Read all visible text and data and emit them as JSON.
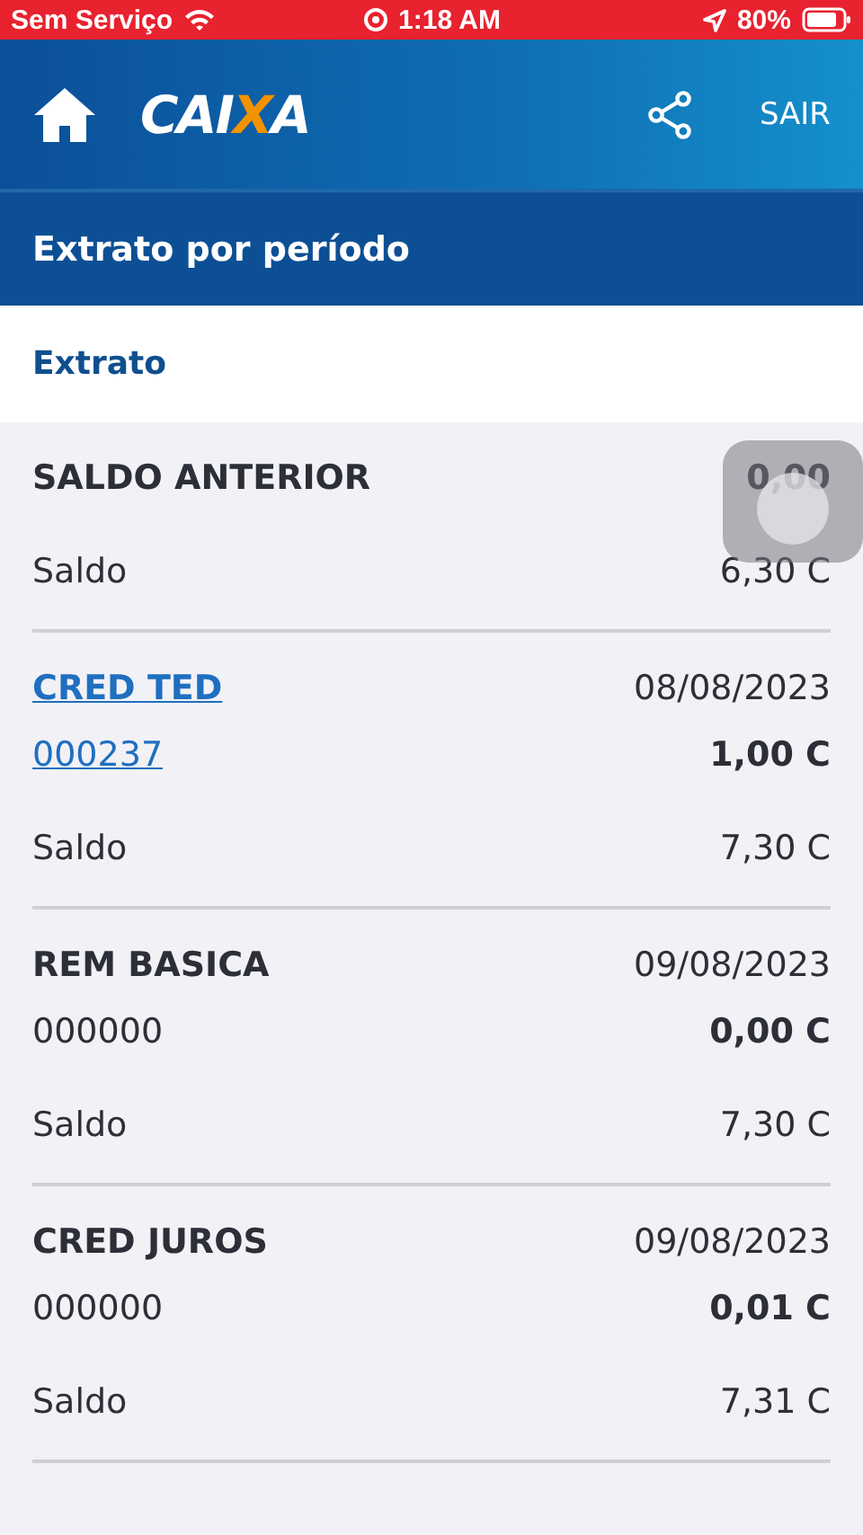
{
  "status_bar": {
    "carrier": "Sem Serviço",
    "time": "1:18 AM",
    "battery": "80%"
  },
  "header": {
    "logo": "CAIXA",
    "action": "SAIR"
  },
  "page_title": "Extrato por período",
  "section_title": "Extrato",
  "opening": {
    "label": "SALDO ANTERIOR",
    "amount": "0,00",
    "balance_label": "Saldo",
    "balance": "6,30 C"
  },
  "entries": [
    {
      "title": "CRED TED",
      "date": "08/08/2023",
      "document": "000237",
      "amount": "1,00 C",
      "balance_label": "Saldo",
      "balance": "7,30 C",
      "link": true
    },
    {
      "title": "REM BASICA",
      "date": "09/08/2023",
      "document": "000000",
      "amount": "0,00 C",
      "balance_label": "Saldo",
      "balance": "7,30 C",
      "link": false
    },
    {
      "title": "CRED JUROS",
      "date": "09/08/2023",
      "document": "000000",
      "amount": "0,01 C",
      "balance_label": "Saldo",
      "balance": "7,31 C",
      "link": false
    }
  ]
}
